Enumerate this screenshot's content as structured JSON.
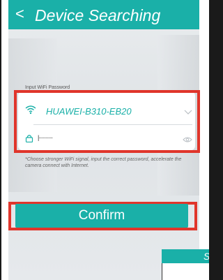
{
  "header": {
    "back_icon": "chevron-left-icon",
    "title": "Device Searching"
  },
  "form": {
    "label": "Input WiFi Password",
    "ssid": "HUAWEI-B310-EB20",
    "password_masked": "|··········",
    "hint": "*Choose stronger WiFi signal, input the correct password, accelerate the camera connect with Internet."
  },
  "confirm_label": "Confirm",
  "popup": {
    "header_text": "S"
  },
  "colors": {
    "accent": "#1ab0a8",
    "highlight": "#e0352b"
  }
}
